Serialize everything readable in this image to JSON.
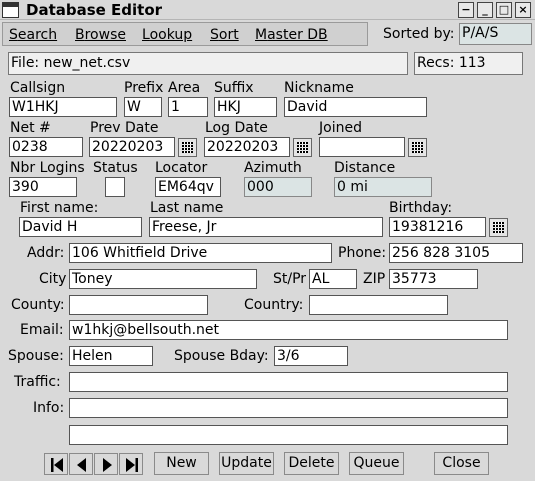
{
  "window": {
    "title": "Database Editor"
  },
  "menu": {
    "items": [
      {
        "first": "S",
        "rest": "earch"
      },
      {
        "first": "B",
        "rest": "rowse"
      },
      {
        "first": "L",
        "rest": "ookup"
      },
      {
        "first": "S",
        "rest": "ort"
      },
      {
        "first": "M",
        "rest": "aster DB"
      }
    ]
  },
  "sort": {
    "label": "Sorted by:",
    "value": "P/A/S"
  },
  "file": {
    "text": "File: new_net.csv",
    "recs": "Recs: 113"
  },
  "labels": {
    "callsign": "Callsign",
    "prefix": "Prefix",
    "area": "Area",
    "suffix": "Suffix",
    "nickname": "Nickname",
    "net": "Net #",
    "prev_date": "Prev Date",
    "log_date": "Log Date",
    "joined": "Joined",
    "nbr_logins": "Nbr Logins",
    "status": "Status",
    "locator": "Locator",
    "azimuth": "Azimuth",
    "distance": "Distance",
    "first_name": "First name:",
    "last_name": "Last name",
    "birthday": "Birthday:",
    "addr": "Addr:",
    "phone": "Phone:",
    "city": "City",
    "state": "St/Pr",
    "zip": "ZIP",
    "county": "County:",
    "country": "Country:",
    "email": "Email:",
    "spouse": "Spouse:",
    "spouse_bday": "Spouse Bday:",
    "traffic": "Traffic:",
    "info": "Info:"
  },
  "values": {
    "callsign": "W1HKJ",
    "prefix": "W",
    "area": "1",
    "suffix": "HKJ",
    "nickname": "David",
    "net": "0238",
    "prev_date": "20220203",
    "log_date": "20220203",
    "joined": "",
    "nbr_logins": "390",
    "status": "",
    "locator": "EM64qv",
    "azimuth": "000",
    "distance": "0  mi",
    "first_name": "David H",
    "last_name": "Freese, Jr",
    "birthday": "19381216",
    "addr": "106 Whitfield Drive",
    "phone": "256 828 3105",
    "city": "Toney",
    "state": "AL",
    "zip": "35773",
    "county": "",
    "country": "",
    "email": "w1hkj@bellsouth.net",
    "spouse": "Helen",
    "spouse_bday": "3/6",
    "traffic": "",
    "info": "",
    "info2": ""
  },
  "buttons": {
    "new": "New",
    "update": "Update",
    "delete": "Delete",
    "queue": "Queue",
    "close": "Close"
  },
  "icons": {
    "window": "app-icon",
    "minimize": "minimize-icon",
    "maximize": "maximize-icon",
    "close": "close-icon",
    "calendar": "calendar-icon",
    "first": "first-record-icon",
    "prev": "prev-record-icon",
    "next": "next-record-icon",
    "last": "last-record-icon"
  }
}
